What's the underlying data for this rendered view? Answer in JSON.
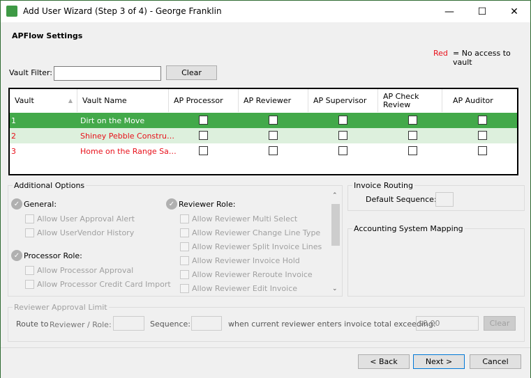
{
  "window": {
    "title": "Add User Wizard (Step 3 of 4) - George Franklin",
    "minimize": "—",
    "maximize": "☐",
    "close": "✕"
  },
  "heading": "APFlow Settings",
  "legend": {
    "red_word": "Red",
    "text": "= No access to vault",
    "red_color": "#e8101a"
  },
  "filter": {
    "label": "Vault Filter:",
    "value": "",
    "clear": "Clear"
  },
  "grid": {
    "columns": [
      "Vault",
      "Vault Name",
      "AP Processor",
      "AP Reviewer",
      "AP Supervisor",
      "AP Check Review",
      "AP Auditor"
    ],
    "rows": [
      {
        "vault": "1",
        "name": "Dirt on the Move",
        "no_access": false,
        "selected": true,
        "checks": [
          false,
          false,
          false,
          false,
          false
        ]
      },
      {
        "vault": "2",
        "name": "Shiney Pebble Constru…",
        "no_access": true,
        "selected": false,
        "checks": [
          false,
          false,
          false,
          false,
          false
        ]
      },
      {
        "vault": "3",
        "name": "Home on the Range Sa…",
        "no_access": true,
        "selected": false,
        "checks": [
          false,
          false,
          false,
          false,
          false
        ]
      }
    ],
    "selected_color": "#43a94a"
  },
  "options": {
    "title": "Additional Options",
    "general": {
      "label": "General:",
      "items": [
        "Allow User Approval Alert",
        "Allow UserVendor History"
      ]
    },
    "processor": {
      "label": "Processor Role:",
      "items": [
        "Allow Processor Approval",
        "Allow Processor Credit Card Import"
      ]
    },
    "reviewer": {
      "label": "Reviewer Role:",
      "items": [
        "Allow Reviewer Multi Select",
        "Allow Reviewer Change Line Type",
        "Allow Reviewer Split Invoice Lines",
        "Allow Reviewer Invoice Hold",
        "Allow Reviewer Reroute Invoice",
        "Allow Reviewer Edit Invoice"
      ]
    }
  },
  "routing": {
    "title": "Invoice Routing",
    "default_sequence_label": "Default Sequence:",
    "default_sequence": ""
  },
  "mapping": {
    "title": "Accounting System Mapping"
  },
  "limit": {
    "title": "Reviewer Approval Limit",
    "route_to": "Route to",
    "reviewer_role": "Reviewer / Role:",
    "sequence": "Sequence:",
    "when": "when current reviewer enters invoice total exceeding:",
    "amount": "$0.00",
    "clear": "Clear"
  },
  "footer": {
    "back": "< Back",
    "next": "Next >",
    "cancel": "Cancel"
  }
}
